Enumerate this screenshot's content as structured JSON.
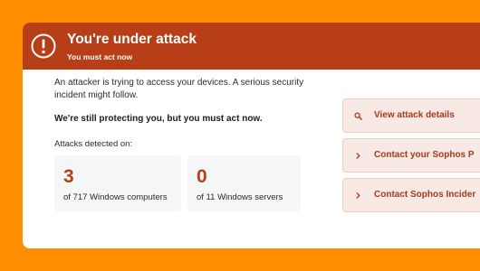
{
  "alert": {
    "title": "You're under attack",
    "subtitle": "You must act now",
    "icon": "exclamation-circle-icon"
  },
  "message": "An attacker is trying to access your devices. A serious security incident might follow.",
  "emphasis": "We're still protecting you, but you must act now.",
  "attacks_label": "Attacks detected on:",
  "stats": {
    "computers": {
      "value": "3",
      "caption": "of 717 Windows computers"
    },
    "servers": {
      "value": "0",
      "caption": "of 11 Windows servers"
    }
  },
  "actions": [
    {
      "label": "View attack details",
      "icon": "search-icon"
    },
    {
      "label": "Contact your Sophos P",
      "icon": "chevron-right-icon"
    },
    {
      "label": "Contact Sophos Incider",
      "icon": "chevron-right-icon"
    }
  ],
  "colors": {
    "background": "#FF8F00",
    "alert_header": "#B73E17",
    "accent_text": "#A8391A",
    "button_fill": "#F8E9E4",
    "card_fill": "#F5F6F8"
  }
}
